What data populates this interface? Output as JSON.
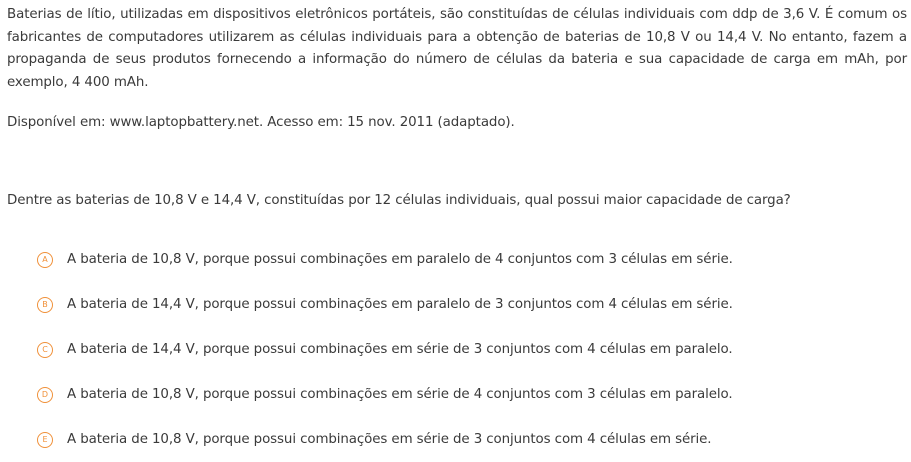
{
  "context": {
    "paragraph": "Baterias de lítio, utilizadas em dispositivos eletrônicos portáteis, são constituídas de células individuais com ddp de 3,6 V. É comum os fabricantes de computadores utilizarem as células individuais para a obtenção de baterias de 10,8 V ou 14,4 V. No entanto, fazem a propaganda de seus produtos fornecendo a informação do número de células da bateria e sua capacidade de carga em mAh, por exemplo, 4 400 mAh.",
    "source": "Disponível em: www.laptopbattery.net. Acesso em: 15 nov. 2011 (adaptado)."
  },
  "question": "Dentre as baterias de 10,8 V e 14,4 V, constituídas por 12 células individuais, qual possui maior capacidade de carga?",
  "options": [
    {
      "letter": "A",
      "text": "A bateria de 10,8 V, porque possui combinações em paralelo de 4 conjuntos com 3 células em série."
    },
    {
      "letter": "B",
      "text": "A bateria de 14,4 V, porque possui combinações em paralelo de 3 conjuntos com 4 células em série."
    },
    {
      "letter": "C",
      "text": "A bateria de 14,4 V, porque possui combinações em série de 3 conjuntos com 4 células em paralelo."
    },
    {
      "letter": "D",
      "text": "A bateria de 10,8 V, porque possui combinações em série de 4 conjuntos com 3 células em paralelo."
    },
    {
      "letter": "E",
      "text": "A bateria de 10,8 V, porque possui combinações em série de 3 conjuntos com 4 células em série."
    }
  ],
  "colors": {
    "accent": "#f0913a",
    "text": "#3a3a3a"
  }
}
